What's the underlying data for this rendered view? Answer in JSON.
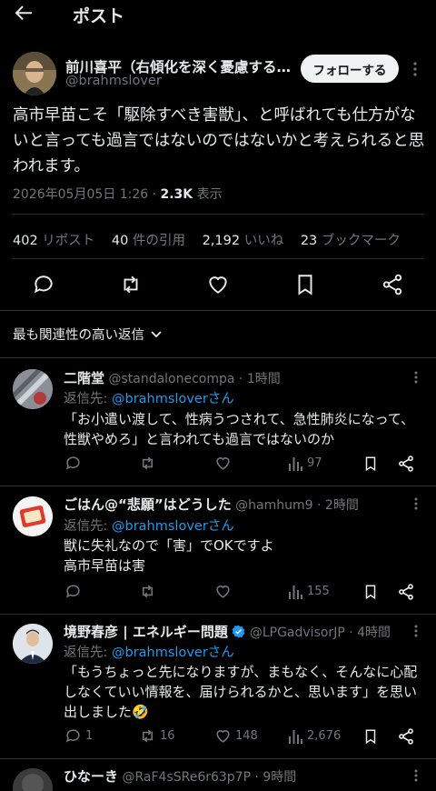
{
  "header": {
    "title": "ポスト"
  },
  "post": {
    "author_name": "前川喜平（右傾化を深く憂慮する…",
    "author_handle": "@brahmslover",
    "follow_label": "フォローする",
    "text": "高市早苗こそ「駆除すべき害獣」、と呼ばれても仕方がないと言っても過言ではないのではないかと考えられると思われます。",
    "timestamp": "2026年05月05日 1:26 · ",
    "views": "2.3K",
    "views_label": " 表示",
    "stats": {
      "reposts": "402",
      "reposts_label": " リポスト",
      "quotes": "40",
      "quotes_label": " 件の引用",
      "likes": "2,192",
      "likes_label": " いいね",
      "bookmarks": "23",
      "bookmarks_label": " ブックマーク"
    }
  },
  "sort": {
    "label": "最も関連性の高い返信"
  },
  "replies": [
    {
      "name": "二階堂",
      "handle": "@standalonecompa",
      "time": " · 1時間",
      "reply_to_prefix": "返信先: ",
      "reply_to_user": "@brahmsloverさん",
      "text_lines": [
        "「お小遣い渡して、性病うつされて、急性肺炎になって、",
        "性獣やめろ」と言われても過言ではないのか"
      ],
      "replies": "",
      "reposts": "",
      "likes": "",
      "views": "97"
    },
    {
      "name": "ごはん@“悲願”はどうした",
      "handle": "@hamhum9",
      "time": " · 2時間",
      "reply_to_prefix": "返信先: ",
      "reply_to_user": "@brahmsloverさん",
      "text_lines": [
        "獣に失礼なので「害」でOKですよ",
        "高市早苗は害"
      ],
      "replies": "",
      "reposts": "",
      "likes": "",
      "views": "155"
    },
    {
      "name": "境野春彦 | エネルギー問題",
      "handle": "@LPGadvisorJP",
      "time": " · 4時間",
      "reply_to_prefix": "返信先: ",
      "reply_to_user": "@brahmsloverさん",
      "text_lines": [
        "「もうちょっと先になりますが、まもなく、そんなに心配",
        "しなくていい情報を、届けられるかと、思います」を思い",
        "出しました🤣"
      ],
      "replies": "1",
      "reposts": "16",
      "likes": "148",
      "views": "2,676"
    },
    {
      "name": "ひなーき",
      "handle": "@RaF4sSRe6r63p7P",
      "time": " · 9時間"
    }
  ],
  "colors": {
    "accent": "#1d9bf0",
    "muted": "#71767b",
    "background": "#000000",
    "verified": "#1d9bf0"
  }
}
